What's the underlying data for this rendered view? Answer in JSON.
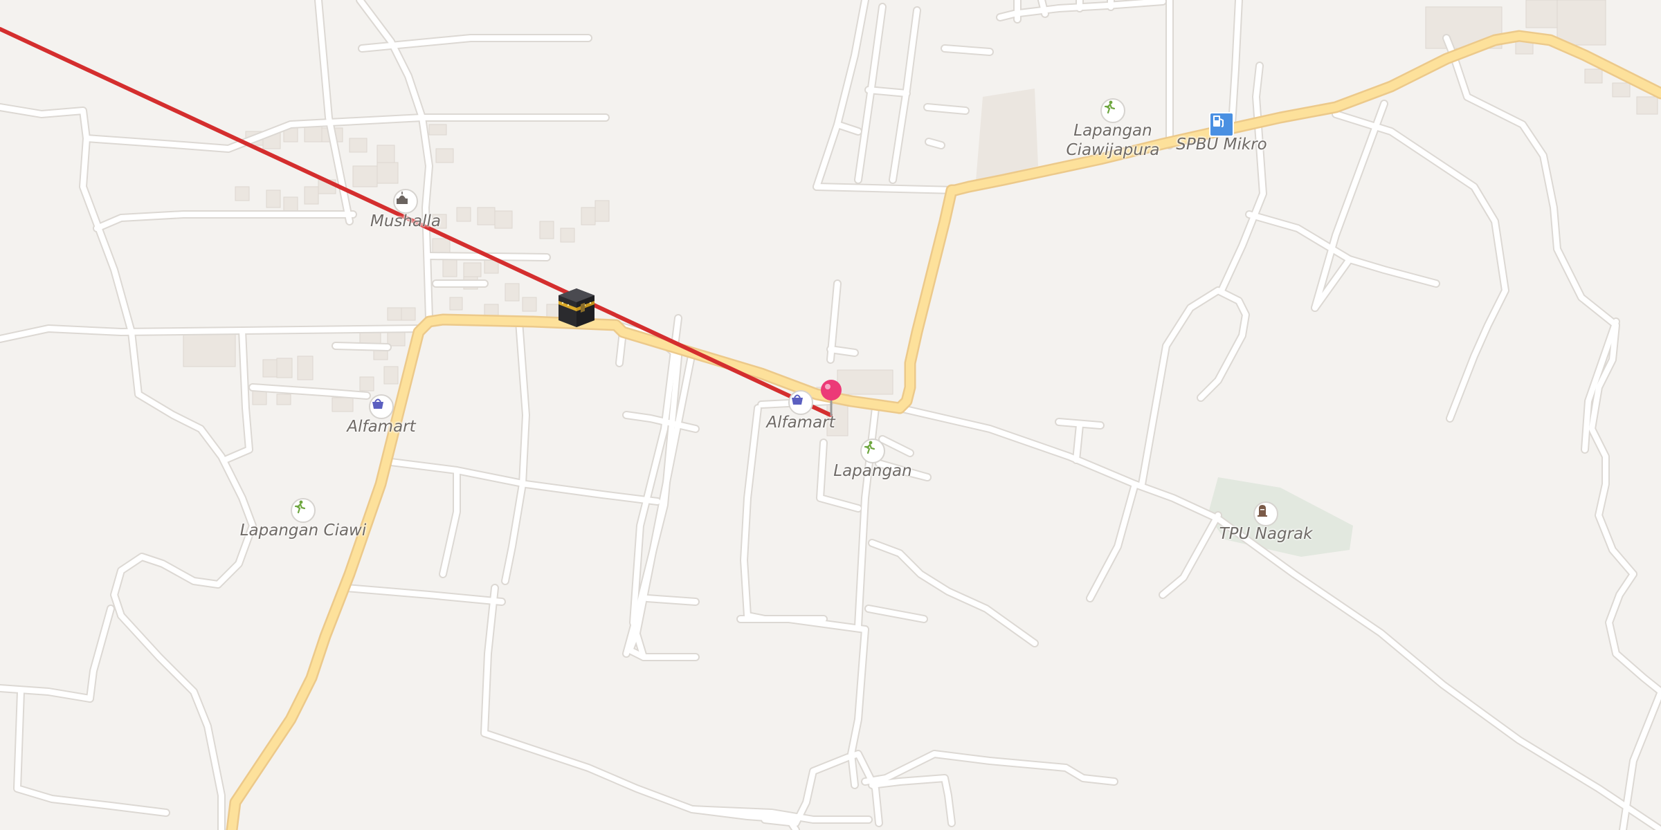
{
  "map": {
    "colors": {
      "background": "#f4f2ef",
      "minor_road": "#ffffff",
      "minor_road_casing": "#dcd8d3",
      "major_road": "#fde19b",
      "major_road_casing": "#ecc98a",
      "building": "#ebe6e0",
      "building_edge": "#ddd7cf",
      "cemetery_area": "#e2e8df",
      "qibla_line": "#d42e2e",
      "pin": "#ec3a77",
      "poi_recreation": "#6ea63f",
      "poi_shop": "#5b5fc0",
      "poi_fuel": "#4a90e2",
      "poi_cemetery": "#7a5a48",
      "poi_worship": "#6b6460"
    },
    "pois": [
      {
        "name": "Mushalla",
        "icon": "mosque-icon",
        "category": "worship"
      },
      {
        "name": "Alfamart",
        "icon": "shopping-basket-icon",
        "category": "shop"
      },
      {
        "name": "Alfamart",
        "icon": "shopping-basket-icon",
        "category": "shop"
      },
      {
        "name": "Lapangan Ciawi",
        "icon": "running-person-icon",
        "category": "recreation"
      },
      {
        "name": "Lapangan",
        "icon": "running-person-icon",
        "category": "recreation"
      },
      {
        "name": "Lapangan\nCiawijapura",
        "icon": "running-person-icon",
        "category": "recreation"
      },
      {
        "name": "SPBU Mikro",
        "icon": "fuel-pump-icon",
        "category": "fuel"
      },
      {
        "name": "TPU Nagrak",
        "icon": "cemetery-icon",
        "category": "cemetery"
      }
    ],
    "markers": {
      "kaaba": {
        "icon": "kaaba-icon"
      },
      "location_pin": {
        "icon": "map-pin-icon"
      }
    }
  }
}
